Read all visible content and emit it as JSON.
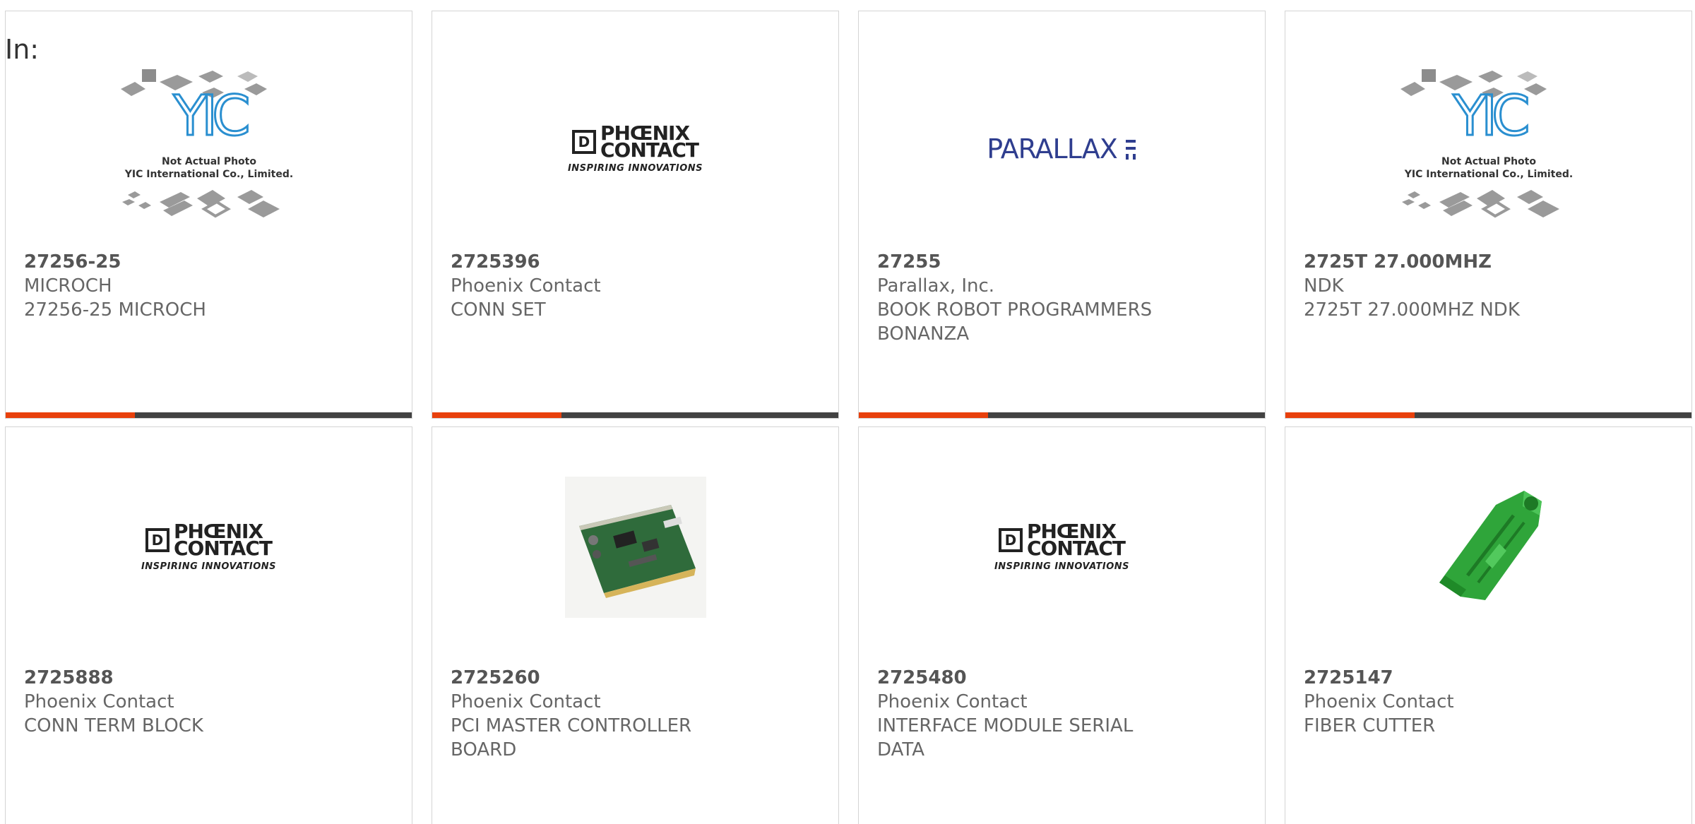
{
  "header": {
    "in_label": "In:"
  },
  "colors": {
    "accent": "#e8400c",
    "bar": "#424242",
    "border": "#d4d4d4"
  },
  "cards": [
    {
      "part_number": "27256-25",
      "manufacturer": "MICROCH",
      "description": "27256-25 MICROCH",
      "image": "yic-placeholder",
      "image_text_1": "Not Actual Photo",
      "image_text_2": "YIC International Co., Limited."
    },
    {
      "part_number": "2725396",
      "manufacturer": "Phoenix Contact",
      "description": "CONN SET",
      "image": "phoenix-contact-logo",
      "logo_line1": "PHŒNIX",
      "logo_line2": "CONTACT",
      "logo_tag": "INSPIRING INNOVATIONS"
    },
    {
      "part_number": "27255",
      "manufacturer": "Parallax, Inc.",
      "description": "BOOK ROBOT PROGRAMMERS BONANZA",
      "image": "parallax-logo",
      "logo_text": "PARALLAX"
    },
    {
      "part_number": "2725T 27.000MHZ",
      "manufacturer": "NDK",
      "description": "2725T 27.000MHZ NDK",
      "image": "yic-placeholder",
      "image_text_1": "Not Actual Photo",
      "image_text_2": "YIC International Co., Limited."
    },
    {
      "part_number": "2725888",
      "manufacturer": "Phoenix Contact",
      "description": "CONN TERM BLOCK",
      "image": "phoenix-contact-logo",
      "logo_line1": "PHŒNIX",
      "logo_line2": "CONTACT",
      "logo_tag": "INSPIRING INNOVATIONS"
    },
    {
      "part_number": "2725260",
      "manufacturer": "Phoenix Contact",
      "description": "PCI MASTER CONTROLLER BOARD",
      "image": "pci-board-photo"
    },
    {
      "part_number": "2725480",
      "manufacturer": "Phoenix Contact",
      "description": "INTERFACE MODULE SERIAL DATA",
      "image": "phoenix-contact-logo",
      "logo_line1": "PHŒNIX",
      "logo_line2": "CONTACT",
      "logo_tag": "INSPIRING INNOVATIONS"
    },
    {
      "part_number": "2725147",
      "manufacturer": "Phoenix Contact",
      "description": "FIBER CUTTER",
      "image": "fiber-cutter-photo"
    }
  ]
}
